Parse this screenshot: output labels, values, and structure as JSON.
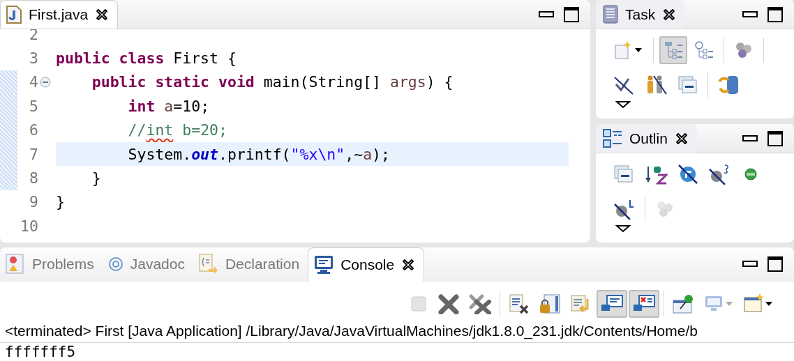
{
  "editor": {
    "tab": {
      "label": "First.java",
      "selected": true
    },
    "lines": [
      {
        "number": "2",
        "in_range": false,
        "current": false,
        "foldable": false
      },
      {
        "number": "3",
        "in_range": false,
        "current": false,
        "foldable": false,
        "tokens": [
          {
            "text": "public class",
            "kind": "keyword"
          },
          {
            "text": " First {",
            "kind": "plain"
          }
        ]
      },
      {
        "number": "4",
        "in_range": true,
        "current": false,
        "foldable": true,
        "tokens": [
          {
            "text": "    public static void",
            "kind": "keyword"
          },
          {
            "text": " main(String[] ",
            "kind": "plain"
          },
          {
            "text": "args",
            "kind": "variable"
          },
          {
            "text": ") {",
            "kind": "plain"
          }
        ]
      },
      {
        "number": "5",
        "in_range": true,
        "current": false,
        "foldable": false,
        "tokens": [
          {
            "text": "        int ",
            "kind": "keyword"
          },
          {
            "text": "a",
            "kind": "variable"
          },
          {
            "text": "=10;",
            "kind": "plain"
          }
        ]
      },
      {
        "number": "6",
        "in_range": true,
        "current": false,
        "foldable": false,
        "tokens": [
          {
            "text": "        //",
            "kind": "comment"
          },
          {
            "text": "int",
            "kind": "misspelled"
          },
          {
            "text": " b=20;",
            "kind": "comment"
          }
        ]
      },
      {
        "number": "7",
        "in_range": true,
        "current": true,
        "foldable": false,
        "tokens": [
          {
            "text": "        System.",
            "kind": "plain"
          },
          {
            "text": "out",
            "kind": "field"
          },
          {
            "text": ".printf(",
            "kind": "plain"
          },
          {
            "text": "\"%x\\n\"",
            "kind": "string"
          },
          {
            "text": ",~",
            "kind": "plain"
          },
          {
            "text": "a",
            "kind": "variable"
          },
          {
            "text": ");",
            "kind": "plain"
          }
        ]
      },
      {
        "number": "8",
        "in_range": true,
        "current": false,
        "foldable": false,
        "tokens": [
          {
            "text": "    }",
            "kind": "plain"
          }
        ]
      },
      {
        "number": "9",
        "in_range": false,
        "current": false,
        "foldable": false,
        "tokens": [
          {
            "text": "}",
            "kind": "plain"
          }
        ]
      },
      {
        "number": "10",
        "in_range": false,
        "current": false,
        "foldable": false
      }
    ]
  },
  "task_view": {
    "tab": {
      "label": "Task"
    },
    "toolbar_rows": [
      [
        {
          "kind": "new",
          "pressed": false
        },
        {
          "kind": "separator"
        },
        {
          "kind": "hierarchy",
          "pressed": true
        },
        {
          "kind": "schedule",
          "pressed": false
        },
        {
          "kind": "separator"
        },
        {
          "kind": "circles",
          "pressed": false
        },
        {
          "kind": "separator"
        }
      ],
      [
        {
          "kind": "strike",
          "pressed": false
        },
        {
          "kind": "people",
          "pressed": false
        },
        {
          "kind": "collapse",
          "pressed": false
        },
        {
          "kind": "separator"
        },
        {
          "kind": "sync",
          "pressed": false
        }
      ]
    ]
  },
  "outline_view": {
    "tab": {
      "label": "Outlin"
    },
    "toolbar_rows": [
      [
        {
          "kind": "collapse",
          "pressed": false
        },
        {
          "kind": "sort",
          "pressed": false
        },
        {
          "kind": "hidefields",
          "pressed": false
        },
        {
          "kind": "hidestatic",
          "pressed": false
        },
        {
          "kind": "greendot",
          "pressed": false
        }
      ],
      [
        {
          "kind": "hidelocal",
          "pressed": false
        },
        {
          "kind": "separator"
        },
        {
          "kind": "faded",
          "pressed": false
        }
      ]
    ]
  },
  "bottom_panel": {
    "tabs": [
      {
        "label": "Problems",
        "kind": "problems",
        "selected": false
      },
      {
        "label": "Javadoc",
        "kind": "javadoc",
        "selected": false
      },
      {
        "label": "Declaration",
        "kind": "declaration",
        "selected": false
      },
      {
        "label": "Console",
        "kind": "console",
        "selected": true
      }
    ],
    "toolbar": [
      {
        "kind": "stop",
        "pressed": false
      },
      {
        "kind": "remove",
        "pressed": false
      },
      {
        "kind": "removeall",
        "pressed": false
      },
      {
        "kind": "separator"
      },
      {
        "kind": "clear",
        "pressed": false
      },
      {
        "kind": "lock",
        "pressed": false
      },
      {
        "kind": "wrap",
        "pressed": false
      },
      {
        "kind": "stdout",
        "pressed": true
      },
      {
        "kind": "stderr",
        "pressed": true
      },
      {
        "kind": "separator"
      },
      {
        "kind": "pin",
        "pressed": false
      },
      {
        "kind": "display",
        "pressed": false
      },
      {
        "kind": "open",
        "pressed": false
      }
    ],
    "status": "<terminated> First [Java Application] /Library/Java/JavaVirtualMachines/jdk1.8.0_231.jdk/Contents/Home/b",
    "output": [
      "fffffff5"
    ]
  }
}
